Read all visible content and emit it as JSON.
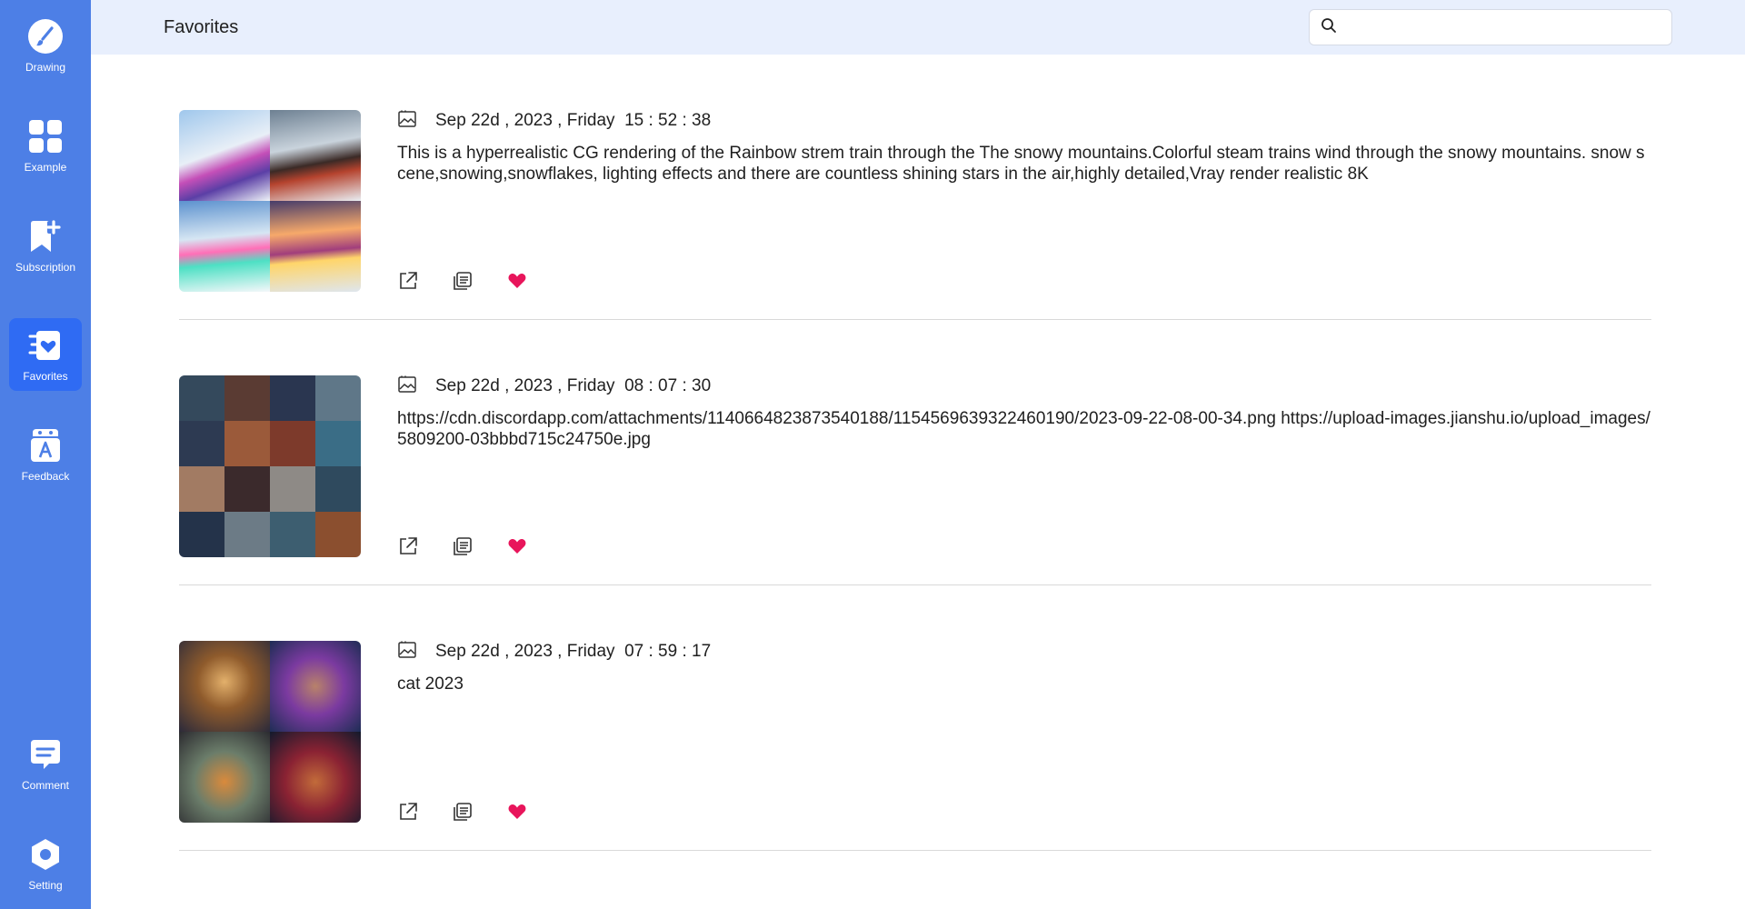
{
  "sidebar": {
    "items": [
      {
        "label": "Drawing",
        "icon": "brush-icon"
      },
      {
        "label": "Example",
        "icon": "grid-icon"
      },
      {
        "label": "Subscription",
        "icon": "bookmark-plus-icon"
      },
      {
        "label": "Favorites",
        "icon": "heart-list-icon",
        "active": true
      },
      {
        "label": "Feedback",
        "icon": "feedback-icon"
      }
    ],
    "bottom_items": [
      {
        "label": "Comment",
        "icon": "comment-icon"
      },
      {
        "label": "Setting",
        "icon": "hexagon-settings-icon"
      }
    ]
  },
  "header": {
    "title": "Favorites",
    "search": {
      "placeholder": "",
      "value": ""
    }
  },
  "colors": {
    "sidebar": "#4d7fe6",
    "sidebar_active": "#2f6bf3",
    "header": "#e8effd",
    "heart": "#e8155b"
  },
  "cards": [
    {
      "date": "Sep 22d , 2023 , Friday  15 : 52 : 38",
      "description": "This is a hyperrealistic CG rendering of the Rainbow strem train through the The snowy mountains.Colorful steam trains wind through the snowy mountains. snow scene,snowing,snowflakes, lighting effects and there are countless shining stars in the air,highly detailed,Vray render realistic 8K",
      "thumbnail": "rainbow trains in snowy mountains"
    },
    {
      "date": "Sep 22d , 2023 , Friday  08 : 07 : 30",
      "description": "https://cdn.discordapp.com/attachments/1140664823873540188/1154569639322460190/2023-09-22-08-00-34.png  https://upload-images.jianshu.io/upload_images/5809200-03bbbd715c24750e.jpg",
      "thumbnail": "cats and women portraits"
    },
    {
      "date": "Sep 22d , 2023 , Friday  07 : 59 : 17",
      "description": "cat 2023",
      "thumbnail": "fantasy cat portraits"
    }
  ]
}
